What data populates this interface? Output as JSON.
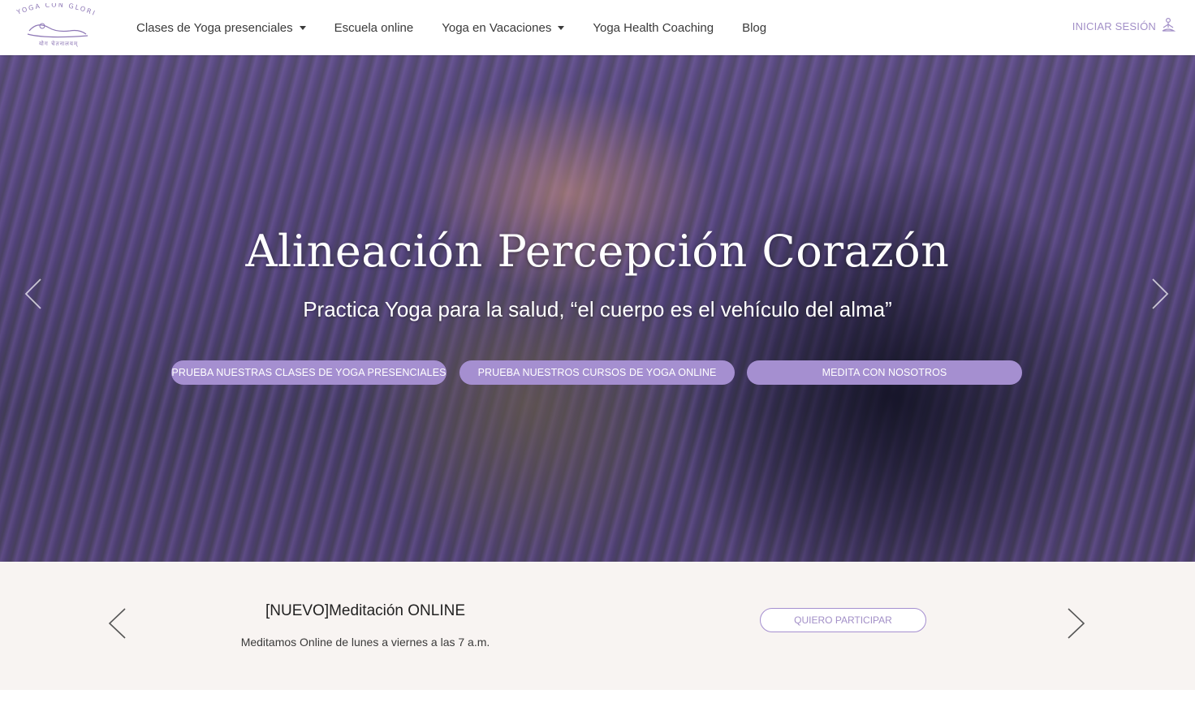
{
  "header": {
    "logo": {
      "arc_text": "YOGA CON GLORIA",
      "subtitle": "योग चेतनालयम्"
    },
    "nav": [
      {
        "label": "Clases de Yoga presenciales",
        "dropdown": true
      },
      {
        "label": "Escuela online",
        "dropdown": false
      },
      {
        "label": "Yoga en Vacaciones",
        "dropdown": true
      },
      {
        "label": "Yoga Health Coaching",
        "dropdown": false
      },
      {
        "label": "Blog",
        "dropdown": false
      }
    ],
    "login_label": "INICIAR SESIÓN",
    "login_icon": "meditation-person-icon"
  },
  "hero": {
    "title": "Alineación Percepción Corazón",
    "subtitle": "Practica Yoga para la salud, “el cuerpo es el vehículo del alma”",
    "buttons": [
      {
        "label": "PRUEBA NUESTRAS CLASES DE YOGA PRESENCIALES"
      },
      {
        "label": "PRUEBA NUESTROS CURSOS DE YOGA ONLINE"
      },
      {
        "label": "MEDITA CON NOSOTROS"
      }
    ],
    "prev_icon": "chevron-left-icon",
    "next_icon": "chevron-right-icon"
  },
  "announcement": {
    "title": "[NUEVO]Meditación ONLINE",
    "text": "Meditamos Online de lunes a viernes a las 7 a.m.",
    "button_label": "QUIERO PARTICIPAR"
  },
  "colors": {
    "accent": "#a58fd0",
    "accent_text": "#a28fc7",
    "band_bg": "#f8f4f2",
    "nav_text": "#3a3a3a"
  }
}
